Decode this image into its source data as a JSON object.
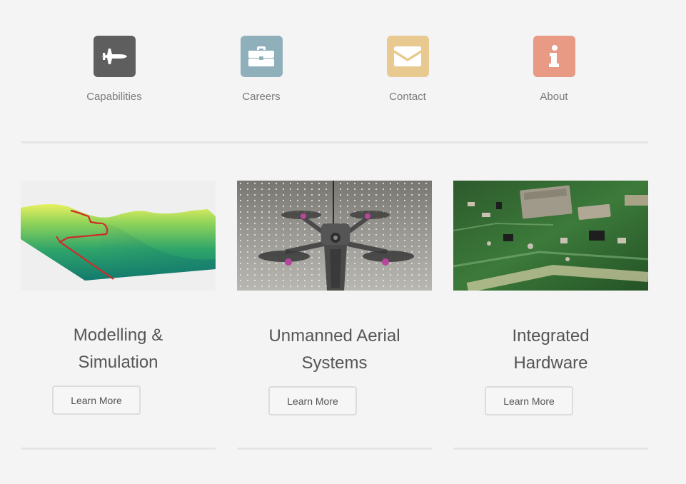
{
  "nav": {
    "items": [
      {
        "label": "Capabilities",
        "icon": "fighter-jet-icon",
        "color": "#5e5e5e"
      },
      {
        "label": "Careers",
        "icon": "briefcase-icon",
        "color": "#8fb0bb"
      },
      {
        "label": "Contact",
        "icon": "envelope-icon",
        "color": "#e8c98f"
      },
      {
        "label": "About",
        "icon": "info-icon",
        "color": "#e89a85"
      }
    ]
  },
  "cards": [
    {
      "title_line1": "Modelling &",
      "title_line2": "Simulation",
      "button": "Learn More",
      "image": "terrain-simulation-image"
    },
    {
      "title_line1": "Unmanned Aerial",
      "title_line2": "Systems",
      "button": "Learn More",
      "image": "quadcopter-drone-image"
    },
    {
      "title_line1": "Integrated",
      "title_line2": "Hardware",
      "button": "Learn More",
      "image": "circuit-board-image"
    }
  ]
}
